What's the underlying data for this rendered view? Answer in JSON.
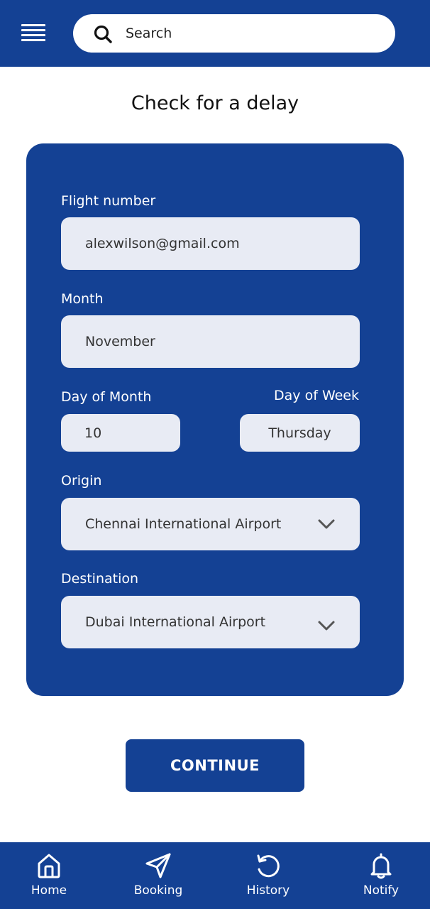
{
  "header": {
    "search_placeholder": "Search"
  },
  "page": {
    "title": "Check for a delay"
  },
  "form": {
    "flight_number": {
      "label": "Flight number",
      "value": "alexwilson@gmail.com"
    },
    "month": {
      "label": "Month",
      "value": "November"
    },
    "day_of_month": {
      "label": "Day of Month",
      "value": "10"
    },
    "day_of_week": {
      "label": "Day of Week",
      "value": "Thursday"
    },
    "origin": {
      "label": "Origin",
      "value": "Chennai International Airport"
    },
    "destination": {
      "label": "Destination",
      "value": "Dubai International Airport"
    }
  },
  "actions": {
    "continue_label": "CONTINUE"
  },
  "nav": {
    "items": [
      {
        "label": "Home",
        "icon": "home-icon"
      },
      {
        "label": "Booking",
        "icon": "send-icon"
      },
      {
        "label": "History",
        "icon": "history-icon"
      },
      {
        "label": "Notify",
        "icon": "bell-icon"
      }
    ]
  },
  "colors": {
    "primary": "#144194",
    "field_bg": "#e8ebf4",
    "background": "#ffffff"
  }
}
